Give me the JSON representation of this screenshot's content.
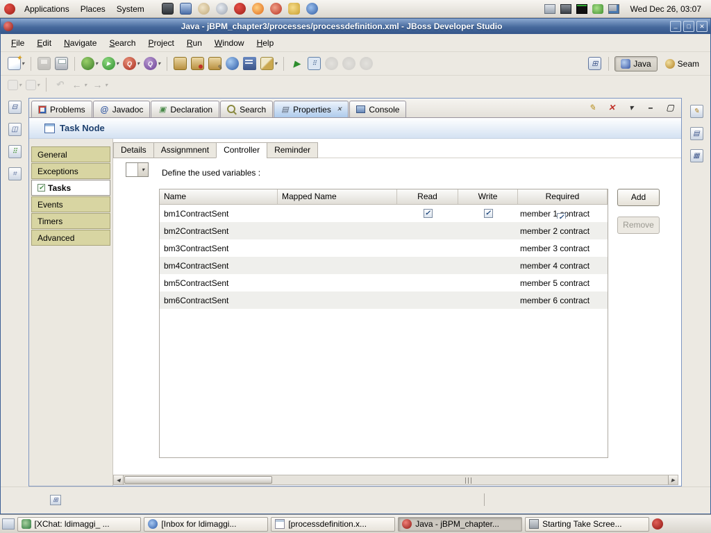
{
  "desktop": {
    "top_panel": {
      "menus": [
        {
          "label": "Applications"
        },
        {
          "label": "Places"
        },
        {
          "label": "System"
        }
      ],
      "clock": "Wed Dec 26, 03:07"
    },
    "taskbar": {
      "buttons": [
        {
          "label": "[XChat: ldimaggi_ ...",
          "active": false
        },
        {
          "label": "[Inbox for ldimaggi...",
          "active": false
        },
        {
          "label": "[processdefinition.x...",
          "active": false
        },
        {
          "label": "Java - jBPM_chapter...",
          "active": true
        },
        {
          "label": "Starting Take Scree...",
          "active": false
        }
      ]
    }
  },
  "window": {
    "title": "Java - jBPM_chapter3/processes/processdefinition.xml - JBoss Developer Studio",
    "menubar": [
      "File",
      "Edit",
      "Navigate",
      "Search",
      "Project",
      "Run",
      "Window",
      "Help"
    ],
    "perspective_bar": {
      "java_label": "Java",
      "seam_label": "Seam"
    }
  },
  "view_tabs": [
    {
      "label": "Problems",
      "active": false
    },
    {
      "label": "Javadoc",
      "active": false
    },
    {
      "label": "Declaration",
      "active": false
    },
    {
      "label": "Search",
      "active": false
    },
    {
      "label": "Properties",
      "active": true
    },
    {
      "label": "Console",
      "active": false
    }
  ],
  "properties_view": {
    "header_title": "Task Node",
    "sidebar_items": [
      {
        "label": "General",
        "selected": false
      },
      {
        "label": "Exceptions",
        "selected": false
      },
      {
        "label": "Tasks",
        "selected": true
      },
      {
        "label": "Events",
        "selected": false
      },
      {
        "label": "Timers",
        "selected": false
      },
      {
        "label": "Advanced",
        "selected": false
      }
    ],
    "detail_tabs": [
      {
        "label": "Details",
        "active": false
      },
      {
        "label": "Assignmnent",
        "active": false
      },
      {
        "label": "Controller",
        "active": true
      },
      {
        "label": "Reminder",
        "active": false
      }
    ],
    "variables_caption": "Define the used variables :",
    "table": {
      "columns": [
        "Name",
        "Mapped Name",
        "Read",
        "Write",
        "Required"
      ],
      "rows": [
        {
          "name": "bm1ContractSent",
          "mapped": "",
          "read": true,
          "write": true,
          "required": "member 1 contract",
          "required_checked": true
        },
        {
          "name": "bm2ContractSent",
          "mapped": "",
          "read": false,
          "write": false,
          "required": "member 2 contract",
          "required_checked": false
        },
        {
          "name": "bm3ContractSent",
          "mapped": "",
          "read": false,
          "write": false,
          "required": "member 3 contract",
          "required_checked": false
        },
        {
          "name": "bm4ContractSent",
          "mapped": "",
          "read": false,
          "write": false,
          "required": "member 4 contract",
          "required_checked": false
        },
        {
          "name": "bm5ContractSent",
          "mapped": "",
          "read": false,
          "write": false,
          "required": "member 5 contract",
          "required_checked": false
        },
        {
          "name": "bm6ContractSent",
          "mapped": "",
          "read": false,
          "write": false,
          "required": "member 6 contract",
          "required_checked": false
        }
      ]
    },
    "add_button": "Add",
    "remove_button": "Remove"
  },
  "colors": {
    "titlebar_blue": "#3e6398",
    "selected_tab_blue": "#aecbec",
    "sidebar_khaki": "#d8d5a2",
    "checkmark_blue": "#20497e"
  }
}
